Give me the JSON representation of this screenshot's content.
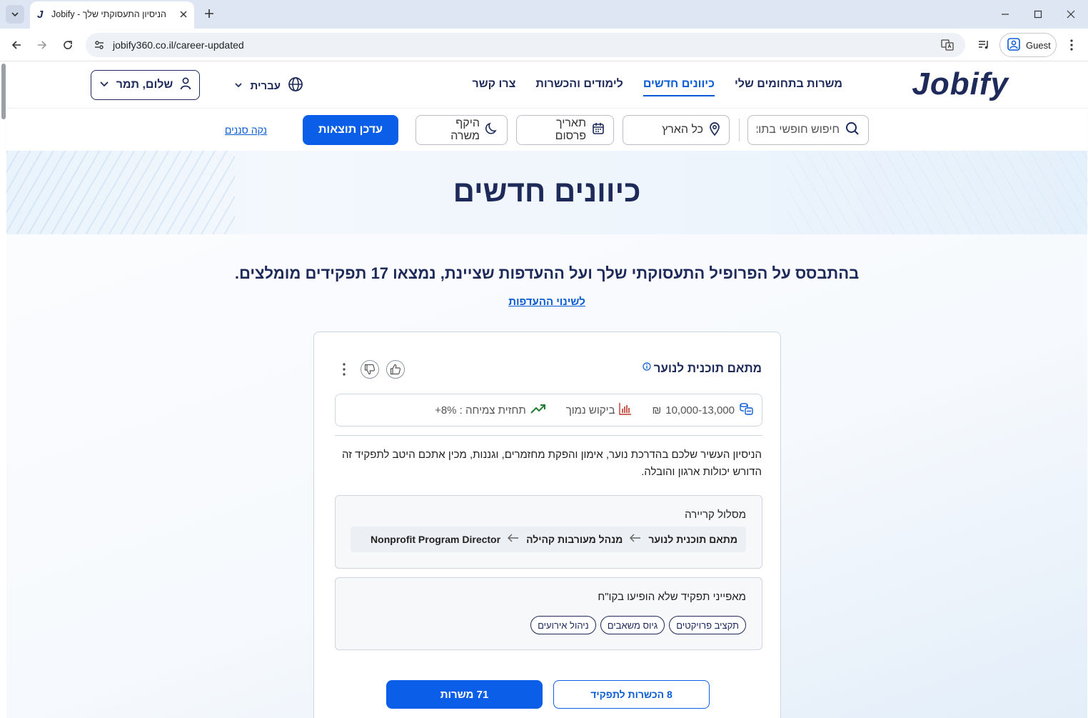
{
  "browser": {
    "tab_title": "Jobify - הניסיון התעסוקתי שלך",
    "tab_favicon": "J",
    "url": "jobify360.co.il/career-updated",
    "profile_label": "Guest",
    "icons": [
      "tab-list-icon",
      "close-icon",
      "plus-icon",
      "minimize-icon",
      "maximize-icon",
      "back-icon",
      "forward-icon",
      "reload-icon",
      "site-settings-icon",
      "translate-icon",
      "media-icon",
      "profile-icon",
      "kebab-icon"
    ]
  },
  "header": {
    "logo": "Jobify",
    "nav": [
      {
        "label": "משרות בתחומים שלי",
        "active": false
      },
      {
        "label": "כיוונים חדשים",
        "active": true
      },
      {
        "label": "לימודים והכשרות",
        "active": false
      },
      {
        "label": "צרו קשר",
        "active": false
      }
    ],
    "language": "עברית",
    "user_greeting": "שלום, תמר"
  },
  "filters": {
    "search_placeholder": "חיפוש חופשי בתוצ...",
    "location": "כל הארץ",
    "date": "תאריך פרסום",
    "scope": "היקף משרה",
    "apply": "עדכן תוצאות",
    "clear": "נקה סננים"
  },
  "hero": {
    "title": "כיוונים חדשים"
  },
  "results": {
    "summary": "בהתבסס על הפרופיל התעסוקתי שלך ועל ההעדפות שציינת, נמצאו 17 תפקידים מומלצים.",
    "change_prefs": "לשינוי ההעדפות"
  },
  "card": {
    "title": "מתאם תוכנית לנוער",
    "salary": "10,000-13,000",
    "currency": "₪",
    "demand": "ביקוש נמוך",
    "growth": "תחזית צמיחה : 8%+",
    "description": "הניסיון העשיר שלכם בהדרכת נוער, אימון והפקת מחזמרים, וגננות, מכין אתכם היטב לתפקיד זה הדורש יכולות ארגון והובלה.",
    "path_label": "מסלול קריירה",
    "path": [
      "מתאם תוכנית לנוער",
      "מנהל מעורבות קהילה",
      "Nonprofit Program Director"
    ],
    "skills_label": "מאפייני תפקיד שלא הופיעו בקו\"ח",
    "skills": [
      "תקציב פרויקטים",
      "גיוס משאבים",
      "ניהול אירועים"
    ],
    "trainings_btn": "8 הכשרות לתפקיד",
    "jobs_btn": "71 משרות"
  },
  "colors": {
    "brand_navy": "#1d2a5a",
    "primary_blue": "#0b5ee8",
    "growth_green": "#1e7d32",
    "demand_red": "#c0392b"
  }
}
